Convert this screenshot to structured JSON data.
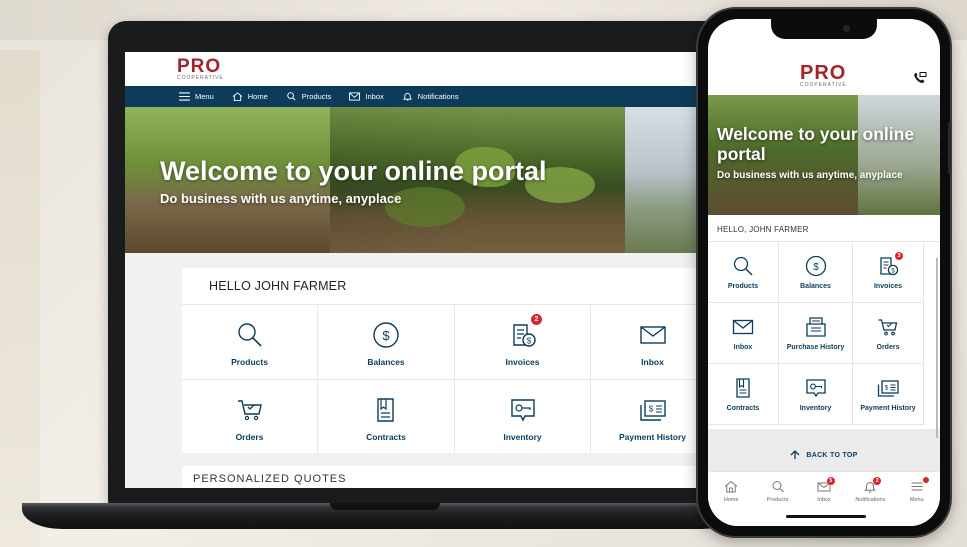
{
  "brand": {
    "name": "PRO",
    "tagline": "COOPERATIVE"
  },
  "colors": {
    "navy": "#0d3b5a",
    "brand_red": "#a5232a",
    "badge_red": "#d7262e"
  },
  "desktop": {
    "nav": [
      {
        "label": "Menu",
        "icon": "menu-icon"
      },
      {
        "label": "Home",
        "icon": "home-icon"
      },
      {
        "label": "Products",
        "icon": "search-icon"
      },
      {
        "label": "Inbox",
        "icon": "mail-icon"
      },
      {
        "label": "Notifications",
        "icon": "bell-icon"
      }
    ],
    "hero": {
      "title": "Welcome to your online portal",
      "subtitle": "Do business with us anytime, anyplace"
    },
    "greeting": "HELLO JOHN FARMER",
    "tiles": [
      {
        "label": "Products",
        "icon": "search-icon"
      },
      {
        "label": "Balances",
        "icon": "dollar-circle-icon"
      },
      {
        "label": "Invoices",
        "icon": "invoice-icon",
        "badge": "2"
      },
      {
        "label": "Inbox",
        "icon": "mail-icon"
      },
      {
        "label": "Orders",
        "icon": "cart-icon"
      },
      {
        "label": "Contracts",
        "icon": "contract-icon"
      },
      {
        "label": "Inventory",
        "icon": "inventory-icon"
      },
      {
        "label": "Payment History",
        "icon": "payment-history-icon"
      }
    ],
    "next_section": "PERSONALIZED QUOTES"
  },
  "mobile": {
    "hero": {
      "title": "Welcome to your online portal",
      "subtitle": "Do business with us anytime, anyplace"
    },
    "greeting": "HELLO, JOHN FARMER",
    "tiles": [
      {
        "label": "Products",
        "icon": "search-icon"
      },
      {
        "label": "Balances",
        "icon": "dollar-circle-icon"
      },
      {
        "label": "Invoices",
        "icon": "invoice-icon",
        "badge": "3"
      },
      {
        "label": "Inbox",
        "icon": "mail-icon"
      },
      {
        "label": "Purchase History",
        "icon": "purchase-history-icon"
      },
      {
        "label": "Orders",
        "icon": "cart-icon"
      },
      {
        "label": "Contracts",
        "icon": "contract-icon"
      },
      {
        "label": "Inventory",
        "icon": "inventory-icon"
      },
      {
        "label": "Payment History",
        "icon": "payment-history-icon"
      }
    ],
    "back_to_top": "BACK TO TOP",
    "tabbar": [
      {
        "label": "Home",
        "icon": "home-icon"
      },
      {
        "label": "Products",
        "icon": "search-icon"
      },
      {
        "label": "Inbox",
        "icon": "mail-icon",
        "badge": "5"
      },
      {
        "label": "Notifications",
        "icon": "bell-icon",
        "badge": "2"
      },
      {
        "label": "Menu",
        "icon": "menu-icon",
        "dot": true
      }
    ]
  }
}
